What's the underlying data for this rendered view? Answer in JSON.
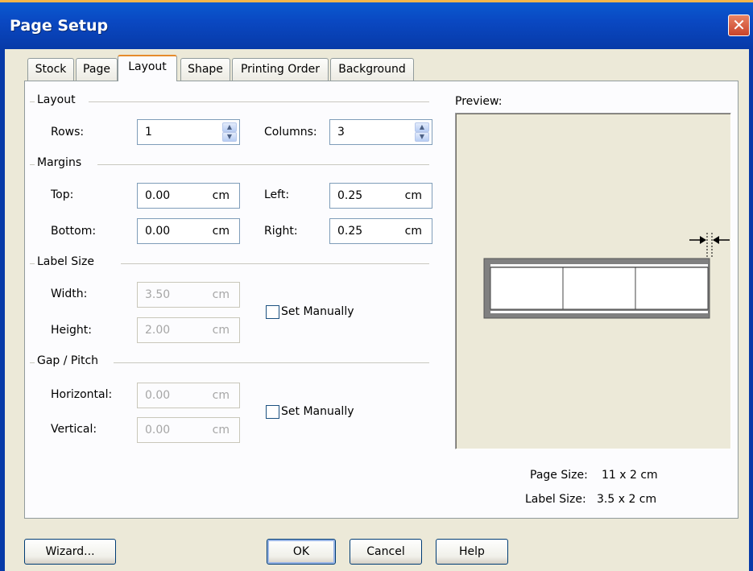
{
  "window": {
    "title": "Page Setup",
    "close_glyph": "✕"
  },
  "tabs": [
    {
      "label": "Stock"
    },
    {
      "label": "Page"
    },
    {
      "label": "Layout",
      "active": true
    },
    {
      "label": "Shape"
    },
    {
      "label": "Printing Order"
    },
    {
      "label": "Background"
    }
  ],
  "layout_group": {
    "title": "Layout",
    "rows_label": "Rows:",
    "rows_value": "1",
    "columns_label": "Columns:",
    "columns_value": "3"
  },
  "margins_group": {
    "title": "Margins",
    "top_label": "Top:",
    "top_value": "0.00",
    "top_unit": "cm",
    "bottom_label": "Bottom:",
    "bottom_value": "0.00",
    "bottom_unit": "cm",
    "left_label": "Left:",
    "left_value": "0.25",
    "left_unit": "cm",
    "right_label": "Right:",
    "right_value": "0.25",
    "right_unit": "cm"
  },
  "label_size_group": {
    "title": "Label Size",
    "width_label": "Width:",
    "width_value": "3.50",
    "width_unit": "cm",
    "height_label": "Height:",
    "height_value": "2.00",
    "height_unit": "cm",
    "set_manually_label": "Set Manually",
    "set_manually_checked": false
  },
  "gap_group": {
    "title": "Gap / Pitch",
    "horizontal_label": "Horizontal:",
    "horizontal_value": "0.00",
    "horizontal_unit": "cm",
    "vertical_label": "Vertical:",
    "vertical_value": "0.00",
    "vertical_unit": "cm",
    "set_manually_label": "Set Manually",
    "set_manually_checked": false
  },
  "preview": {
    "label": "Preview:",
    "page_size_label": "Page Size:",
    "page_size_value": "11 x 2 cm",
    "label_size_label": "Label Size:",
    "label_size_value": "3.5 x 2 cm"
  },
  "buttons": {
    "wizard": "Wizard...",
    "ok": "OK",
    "cancel": "Cancel",
    "help": "Help"
  },
  "colors": {
    "titlebar": "#0a48c2",
    "active_tab_accent": "#e68b2c",
    "close_button": "#c8432a"
  }
}
